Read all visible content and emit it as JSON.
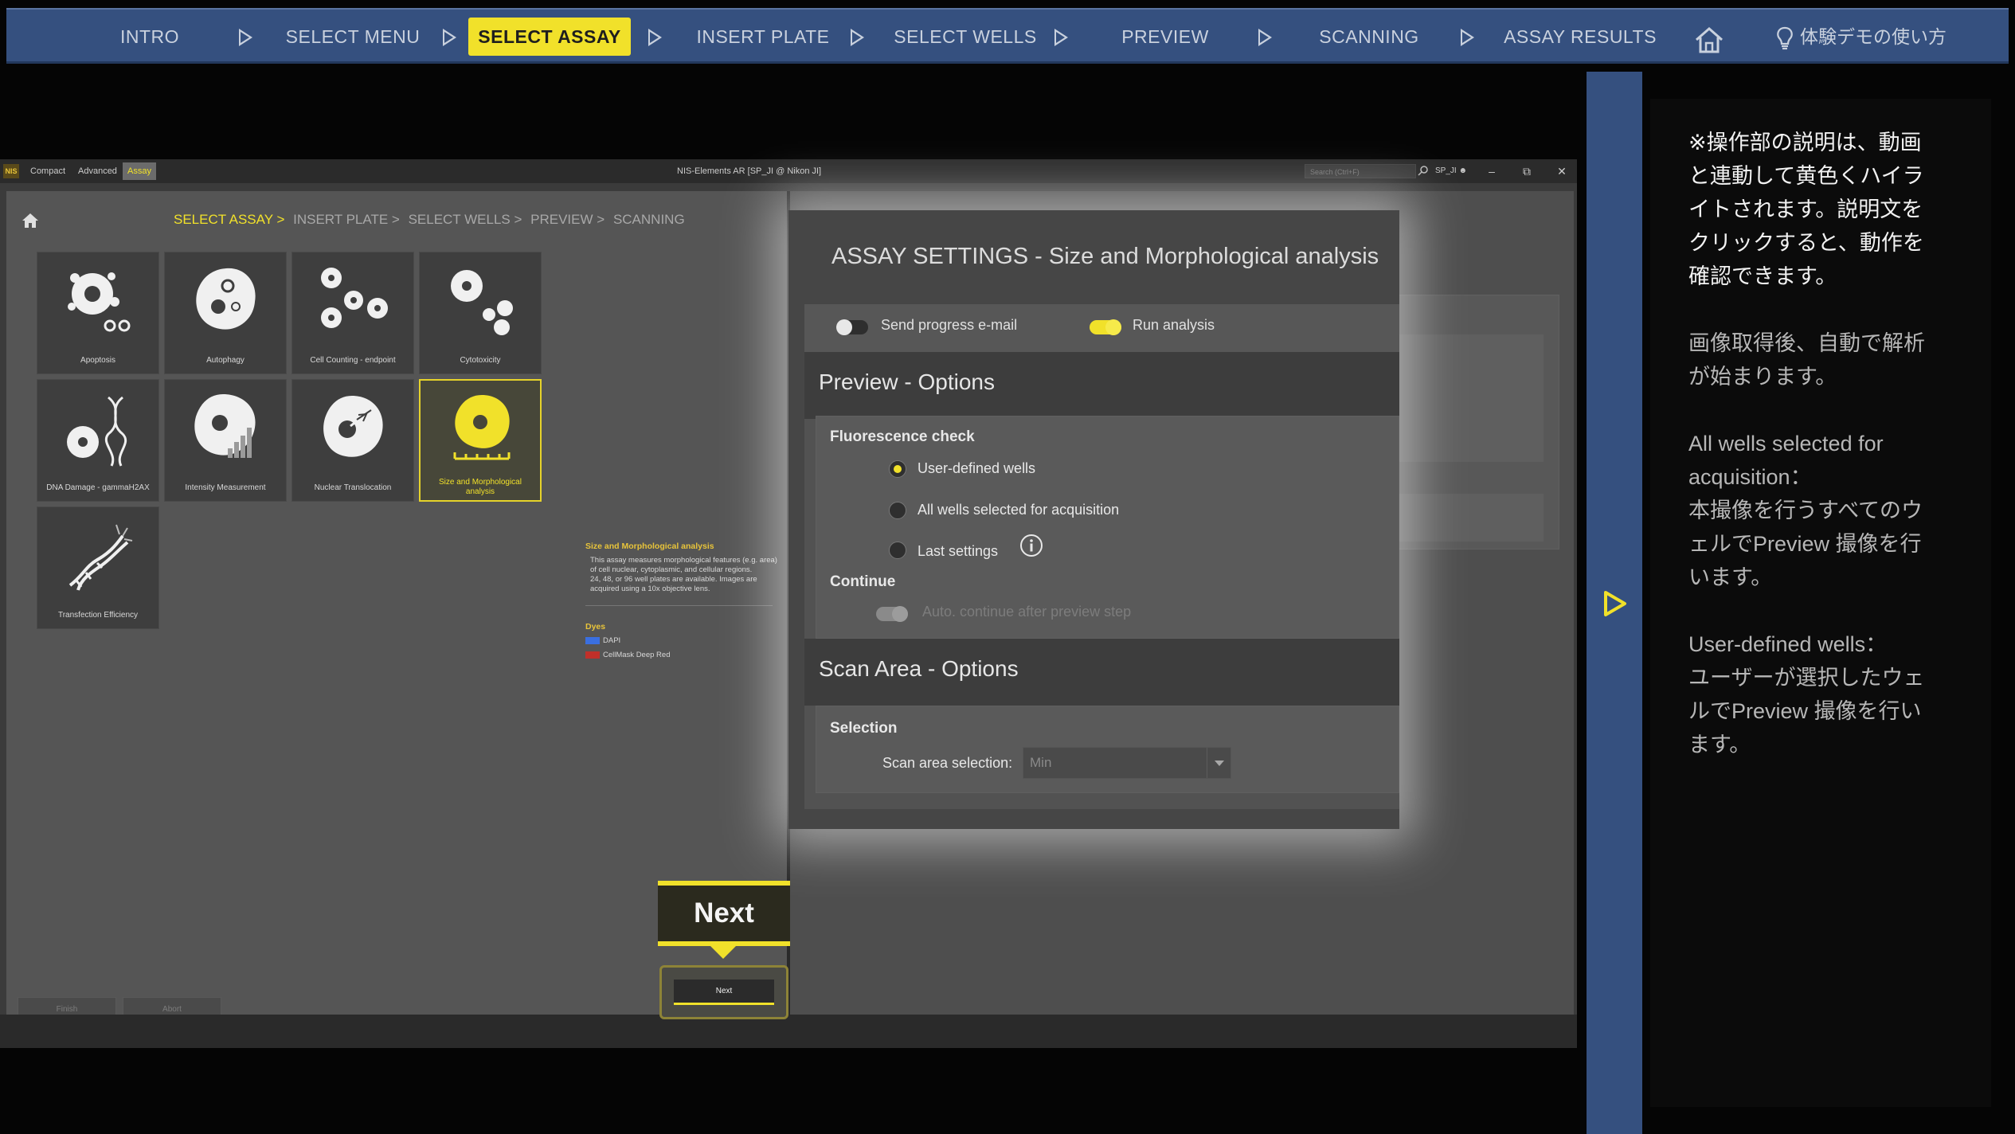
{
  "topnav": {
    "steps": [
      {
        "label": "INTRO"
      },
      {
        "label": "SELECT MENU"
      },
      {
        "label": "SELECT ASSAY"
      },
      {
        "label": "INSERT PLATE"
      },
      {
        "label": "SELECT WELLS"
      },
      {
        "label": "PREVIEW"
      },
      {
        "label": "SCANNING"
      },
      {
        "label": "ASSAY RESULTS"
      }
    ],
    "active_step": "SELECT ASSAY",
    "howto_label": "体験デモの使い方",
    "colors": {
      "bar": "#35507f",
      "active": "#f1e12a"
    }
  },
  "app": {
    "titlebar": {
      "logo": "NIS",
      "tabs": [
        "Compact",
        "Advanced",
        "Assay"
      ],
      "active_tab": "Assay",
      "title": "NIS-Elements AR [SP_JI @ Nikon JI]",
      "search_placeholder": "Search (Ctrl+F)",
      "user": "SP_JI"
    },
    "breadcrumb": [
      "SELECT ASSAY >",
      "INSERT PLATE >",
      "SELECT WELLS >",
      "PREVIEW >",
      "SCANNING"
    ],
    "tiles": [
      {
        "label": "Apoptosis",
        "icon": "apoptosis-icon"
      },
      {
        "label": "Autophagy",
        "icon": "autophagy-icon"
      },
      {
        "label": "Cell Counting - endpoint",
        "icon": "cell-counting-icon"
      },
      {
        "label": "Cytotoxicity",
        "icon": "cytotoxicity-icon"
      },
      {
        "label": "DNA Damage - gammaH2AX",
        "icon": "dna-damage-icon"
      },
      {
        "label": "Intensity Measurement",
        "icon": "intensity-icon"
      },
      {
        "label": "Nuclear Translocation",
        "icon": "nuclear-translocation-icon"
      },
      {
        "label": "Size and Morphological analysis",
        "icon": "size-morphology-icon"
      },
      {
        "label": "Transfection Efficiency",
        "icon": "transfection-icon"
      }
    ],
    "selected_tile": "Size and Morphological analysis",
    "description": {
      "title": "Size and Morphological analysis",
      "body1": "This assay measures morphological features (e.g. area) of cell nuclear, cytoplasmic, and cellular regions.",
      "body2": "24, 48, or 96 well plates are available. Images are acquired using a 10x objective lens.",
      "dyes_title": "Dyes",
      "dyes": [
        {
          "name": "DAPI",
          "color": "#3a6fe0"
        },
        {
          "name": "CellMask Deep Red",
          "color": "#c0302a"
        }
      ]
    },
    "buttons": {
      "finish": "Finish",
      "abort": "Abort",
      "next": "Next"
    }
  },
  "settings": {
    "title": "ASSAY SETTINGS - Size and Morphological analysis",
    "send_email": {
      "label": "Send progress e-mail",
      "on": false
    },
    "run_analysis": {
      "label": "Run analysis",
      "on": true
    },
    "preview_title": "Preview - Options",
    "fluorescence_title": "Fluorescence check",
    "options": [
      {
        "label": "User-defined wells",
        "selected": true
      },
      {
        "label": "All wells selected for acquisition",
        "selected": false
      },
      {
        "label": "Last settings",
        "selected": false
      }
    ],
    "continue_title": "Continue",
    "auto_continue_label": "Auto. continue after preview step",
    "scan_title": "Scan Area - Options",
    "selection_title": "Selection",
    "scan_area_label": "Scan area selection:",
    "scan_area_value": "Min"
  },
  "callout": {
    "label": "Next"
  },
  "sidebar": {
    "p1": [
      "※操作部の説明は、動画",
      "と連動して黄色くハイラ",
      "イトされます。説明文を",
      "クリックすると、動作を",
      "確認できます。"
    ],
    "p2": [
      "画像取得後、自動で解析",
      "が始まります。"
    ],
    "p3": [
      "All wells selected for",
      "acquisition：",
      "本撮像を行うすべてのウ",
      "ェルでPreview 撮像を行",
      "います。"
    ],
    "p4": [
      "User-defined wells：",
      "ユーザーが選択したウェ",
      "ルでPreview 撮像を行い",
      "ます。"
    ]
  }
}
